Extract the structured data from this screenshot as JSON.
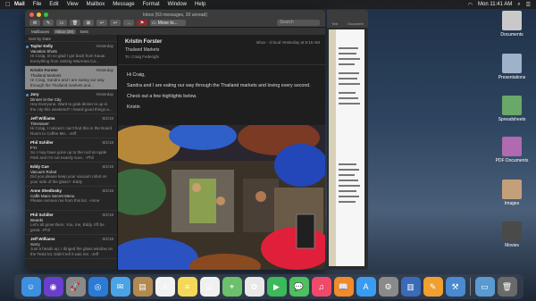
{
  "menubar": {
    "apple": "",
    "app_name": "Mail",
    "menus": [
      "File",
      "Edit",
      "View",
      "Mailbox",
      "Message",
      "Format",
      "Window",
      "Help"
    ],
    "clock": "Mon 11:41 AM"
  },
  "mail": {
    "window_title": "Inbox (53 messages, 30 unread)",
    "toolbar": {
      "move_to": "Move to...",
      "search_placeholder": "Search"
    },
    "favorites": [
      "Mailboxes",
      "Inbox (30)",
      "Sent"
    ],
    "sort_label": "Sort by Date",
    "messages": [
      {
        "from": "Taylor Kelly",
        "date": "Yesterday",
        "subject": "Vacation Shots",
        "preview": "Hi Craig, Im so glad I got back from Kauai. Everything from visiting WaiAnea Ca...",
        "unread": true,
        "selected": false
      },
      {
        "from": "Kristin Forster",
        "date": "Yesterday",
        "subject": "Thailand Markets",
        "preview": "Hi Craig, Sandra and I are eating our way through the Thailand markets and...",
        "unread": false,
        "selected": true
      },
      {
        "from": "Jory",
        "date": "Yesterday",
        "subject": "Dinner in the City",
        "preview": "Hey Everyone, Want to grab dinner to up in the city this weekend? I heard good things a...",
        "unread": true,
        "selected": false
      },
      {
        "from": "Jeff Williams",
        "date": "8/2/18",
        "subject": "Timesaver",
        "preview": "Hi Craig, I noticed I can't find this in the Board Room to Coffee Me.. -Jeff",
        "unread": false,
        "selected": false
      },
      {
        "from": "Phil Schiller",
        "date": "8/2/18",
        "subject": "FYI",
        "preview": "So I may have gone up to the roof at Apple Park and I'm not exactly sure.. -Phil",
        "unread": false,
        "selected": false
      },
      {
        "from": "Eddy Cue",
        "date": "8/2/18",
        "subject": "Vacuum Robot",
        "preview": "Did you please keep your vacuum robot on your side of the glass? -Eddy",
        "unread": false,
        "selected": false
      },
      {
        "from": "Anne Shedlosky",
        "date": "8/2/18",
        "subject": "Caffe Macs Secret Menu",
        "preview": "Please remove me from this list. -Anne",
        "unread": false,
        "selected": false
      },
      {
        "from": "Phil Schiller",
        "date": "8/2/18",
        "subject": "Beards",
        "preview": "Let's all grow them. You, me, Eddy. It'll be great. -Phil",
        "unread": false,
        "selected": false
      },
      {
        "from": "Jeff Williams",
        "date": "8/2/18",
        "subject": "Sorry",
        "preview": "Just a heads up, I dinged the glass window on the Tesla lot. Didn't tell it was me. -Jeff",
        "unread": false,
        "selected": false
      }
    ],
    "reader": {
      "sender": "Kristin Forster",
      "subject": "Thailand Markets",
      "to": "To:  Craig Federighi",
      "meta": "Inbox - iCloud     Yesterday at 8:16 AM",
      "greeting": "Hi Craig,",
      "para1": "Sandra and I are eating our way through the Thailand markets and loving every second.",
      "para2": "Check out a few highlights below.",
      "signoff": "Kristin"
    }
  },
  "pages_window": {
    "tab_a": "Text",
    "tab_b": "Document"
  },
  "desktop_icons": [
    {
      "label": "Documents",
      "color": "#c9c9c9"
    },
    {
      "label": "Presentations",
      "color": "#9fb3c8"
    },
    {
      "label": "Spreadsheets",
      "color": "#6aa86a"
    },
    {
      "label": "PDF Documents",
      "color": "#b06ab0"
    },
    {
      "label": "Images",
      "color": "#c4a07a"
    },
    {
      "label": "Movies",
      "color": "#4a4a4a"
    }
  ],
  "dock": [
    {
      "name": "finder-icon",
      "glyph": "☺",
      "color": "#3d8fe0"
    },
    {
      "name": "siri-icon",
      "glyph": "◉",
      "color": "#6a3fd0"
    },
    {
      "name": "launchpad-icon",
      "glyph": "🚀",
      "color": "#8a8a8a"
    },
    {
      "name": "safari-icon",
      "glyph": "◎",
      "color": "#2a7ad8"
    },
    {
      "name": "mail-icon",
      "glyph": "✉",
      "color": "#4aa3e6"
    },
    {
      "name": "notes-icon",
      "glyph": "▤",
      "color": "#b08a50"
    },
    {
      "name": "calendar-icon",
      "glyph": "4",
      "color": "#f2f2f2"
    },
    {
      "name": "notes-yellow-icon",
      "glyph": "≡",
      "color": "#f4d85a"
    },
    {
      "name": "reminders-icon",
      "glyph": "☑",
      "color": "#f0f0f0"
    },
    {
      "name": "maps-icon",
      "glyph": "⌖",
      "color": "#6cc06c"
    },
    {
      "name": "photos-icon",
      "glyph": "✿",
      "color": "#e8e8e8"
    },
    {
      "name": "facetime-icon",
      "glyph": "▶",
      "color": "#3cb95a"
    },
    {
      "name": "messages-icon",
      "glyph": "💬",
      "color": "#4cc15e"
    },
    {
      "name": "music-icon",
      "glyph": "♫",
      "color": "#f04a6a"
    },
    {
      "name": "books-icon",
      "glyph": "📖",
      "color": "#f08a2a"
    },
    {
      "name": "app-store-icon",
      "glyph": "A",
      "color": "#3a9cf0"
    },
    {
      "name": "system-preferences-icon",
      "glyph": "⚙",
      "color": "#8a8a8a"
    },
    {
      "name": "keynote-icon",
      "glyph": "▥",
      "color": "#3a6ab8"
    },
    {
      "name": "pages-icon",
      "glyph": "✎",
      "color": "#f0a030"
    },
    {
      "name": "xcode-icon",
      "glyph": "⚒",
      "color": "#4a8ad0"
    },
    {
      "name": "downloads-icon",
      "glyph": "▭",
      "color": "#5a9ad0"
    },
    {
      "name": "trash-icon",
      "glyph": "🗑",
      "color": "#6a6a6a"
    }
  ]
}
